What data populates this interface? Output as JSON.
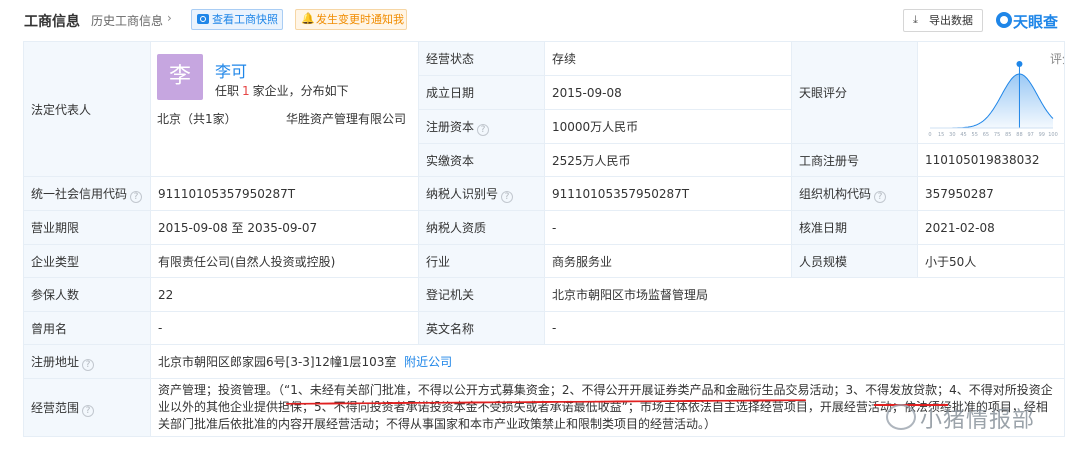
{
  "header": {
    "title": "工商信息",
    "history_link": "历史工商信息",
    "history_chevron": "›",
    "snapshot_button": "查看工商快照",
    "alert_button": "发生变更时通知我",
    "export_button": "导出数据",
    "brand": "天眼查"
  },
  "legal_rep": {
    "label": "法定代表人",
    "avatar_char": "李",
    "name": "李可",
    "note_prefix": "任职",
    "note_count": "1",
    "note_suffix": "家企业，分布如下",
    "city": "北京（共1家）",
    "company": "华胜资产管理有限公司"
  },
  "score": {
    "label": "天眼评分",
    "prefix": "评分",
    "value": "88",
    "value_num": 88,
    "axis_ticks": [
      "0",
      "15",
      "30",
      "45",
      "55",
      "65",
      "75",
      "85",
      "88",
      "97",
      "99",
      "100"
    ],
    "accent": "#1f86e8"
  },
  "rows": {
    "status": {
      "label": "经营状态",
      "value": "存续"
    },
    "founded": {
      "label": "成立日期",
      "value": "2015-09-08"
    },
    "reg_capital": {
      "label": "注册资本",
      "value": "10000万人民币"
    },
    "paid_capital": {
      "label": "实缴资本",
      "value": "2525万人民币"
    },
    "reg_no": {
      "label": "工商注册号",
      "value": "110105019838032"
    },
    "credit_code": {
      "label": "统一社会信用代码",
      "value": "91110105357950287T"
    },
    "taxpayer_id": {
      "label": "纳税人识别号",
      "value": "91110105357950287T"
    },
    "org_code": {
      "label": "组织机构代码",
      "value": "357950287"
    },
    "term": {
      "label": "营业期限",
      "value": "2015-09-08 至 2035-09-07"
    },
    "taxpayer_qual": {
      "label": "纳税人资质",
      "value": "-"
    },
    "approval_date": {
      "label": "核准日期",
      "value": "2021-02-08"
    },
    "company_type": {
      "label": "企业类型",
      "value": "有限责任公司(自然人投资或控股)"
    },
    "industry": {
      "label": "行业",
      "value": "商务服务业"
    },
    "staff_size": {
      "label": "人员规模",
      "value": "小于50人"
    },
    "insured": {
      "label": "参保人数",
      "value": "22"
    },
    "authority": {
      "label": "登记机关",
      "value": "北京市朝阳区市场监督管理局"
    },
    "former_name": {
      "label": "曾用名",
      "value": "-"
    },
    "english_name": {
      "label": "英文名称",
      "value": "-"
    },
    "address": {
      "label": "注册地址",
      "value": "北京市朝阳区郎家园6号[3-3]12幢1层103室",
      "link": "附近公司"
    },
    "scope": {
      "label": "经营范围",
      "value": "资产管理；投资管理。（“1、未经有关部门批准，不得以公开方式募集资金；2、不得公开开展证券类产品和金融衍生品交易活动；3、不得发放贷款；4、不得对所投资企业以外的其他企业提供担保；5、不得向投资者承诺投资本金不受损失或者承诺最低收益”；市场主体依法自主选择经营项目，开展经营活动；依法须经批准的项目，经相关部门批准后依批准的内容开展经营活动；不得从事国家和本市产业政策禁止和限制类项目的经营活动。）"
    }
  },
  "watermark": "小猪情报部"
}
